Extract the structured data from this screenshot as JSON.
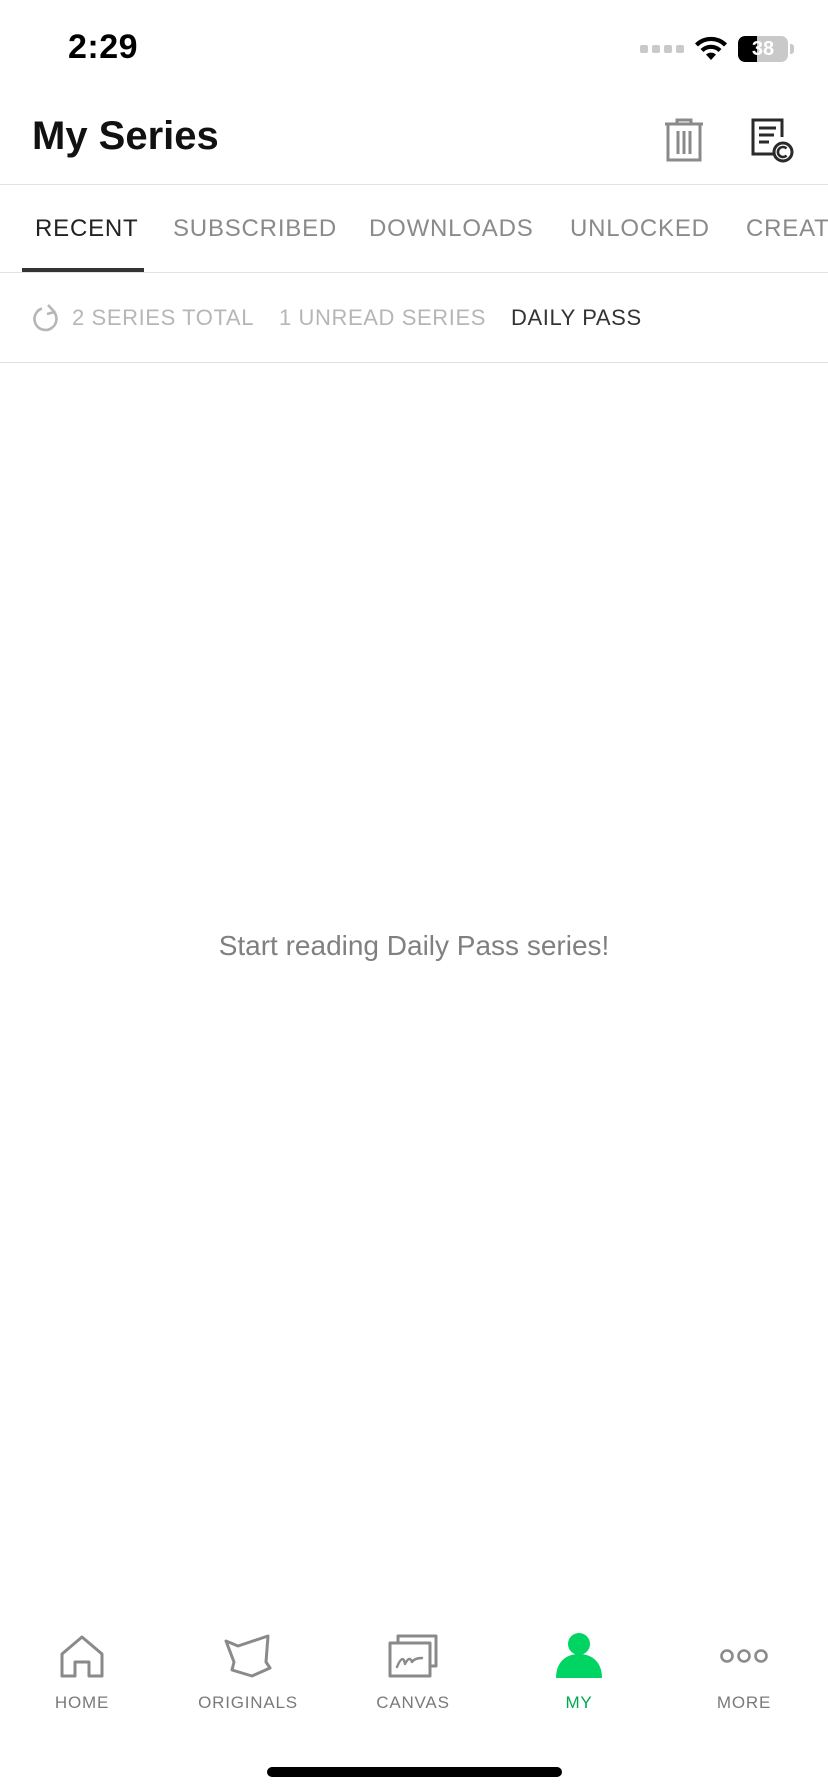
{
  "status_bar": {
    "time": "2:29",
    "battery": "38",
    "battery_level": 0.38
  },
  "header": {
    "title": "My Series",
    "icons": [
      "trash-icon",
      "copyright-list-icon"
    ]
  },
  "tabs": [
    {
      "label": "RECENT",
      "active": true
    },
    {
      "label": "SUBSCRIBED",
      "active": false
    },
    {
      "label": "DOWNLOADS",
      "active": false
    },
    {
      "label": "UNLOCKED",
      "active": false
    },
    {
      "label": "CREATO",
      "active": false
    }
  ],
  "filters": {
    "refresh_icon": "refresh-icon",
    "items": [
      {
        "label": "2 SERIES TOTAL",
        "active": false
      },
      {
        "label": "1 UNREAD SERIES",
        "active": false
      },
      {
        "label": "DAILY PASS",
        "active": true
      }
    ]
  },
  "main": {
    "empty_message": "Start reading Daily Pass series!"
  },
  "bottom_nav": [
    {
      "label": "HOME",
      "icon": "home-icon",
      "active": false
    },
    {
      "label": "ORIGINALS",
      "icon": "originals-icon",
      "active": false
    },
    {
      "label": "CANVAS",
      "icon": "canvas-icon",
      "active": false
    },
    {
      "label": "MY",
      "icon": "person-icon",
      "active": true
    },
    {
      "label": "MORE",
      "icon": "more-icon",
      "active": false
    }
  ],
  "colors": {
    "accent": "#00D564",
    "accent_text": "#00A84F",
    "active_text": "#222222",
    "inactive_text": "#8A8A8A",
    "divider": "#E2E2E2"
  }
}
